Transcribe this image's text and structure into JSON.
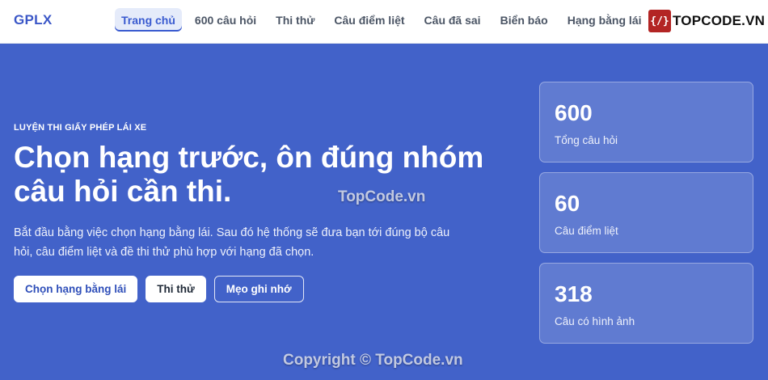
{
  "brand": "GPLX",
  "nav": {
    "items": [
      {
        "label": "Trang chủ",
        "active": true
      },
      {
        "label": "600 câu hỏi",
        "active": false
      },
      {
        "label": "Thi thử",
        "active": false
      },
      {
        "label": "Câu điểm liệt",
        "active": false
      },
      {
        "label": "Câu đã sai",
        "active": false
      },
      {
        "label": "Biển báo",
        "active": false
      },
      {
        "label": "Hạng bằng lái",
        "active": false
      }
    ]
  },
  "logo": {
    "badge": "{/}",
    "text": "TOPCODE.VN"
  },
  "hero": {
    "eyebrow": "LUYỆN THI GIẤY PHÉP LÁI XE",
    "title": "Chọn hạng trước, ôn đúng nhóm câu hỏi cần thi.",
    "description": "Bắt đầu bằng việc chọn hạng bằng lái. Sau đó hệ thống sẽ đưa bạn tới đúng bộ câu hỏi, câu điểm liệt và đề thi thử phù hợp với hạng đã chọn.",
    "buttons": {
      "primary": "Chọn hạng bằng lái",
      "secondary": "Thi thử",
      "outline": "Mẹo ghi nhớ"
    }
  },
  "stats": [
    {
      "value": "600",
      "label": "Tổng câu hỏi"
    },
    {
      "value": "60",
      "label": "Câu điểm liệt"
    },
    {
      "value": "318",
      "label": "Câu có hình ảnh"
    }
  ],
  "watermarks": {
    "center": "TopCode.vn",
    "bottom": "Copyright © TopCode.vn"
  },
  "colors": {
    "hero_bg": "#4262c9",
    "brand": "#3b57c7",
    "nav_active_bg": "#e5ebfa",
    "logo_red": "#b32524"
  }
}
